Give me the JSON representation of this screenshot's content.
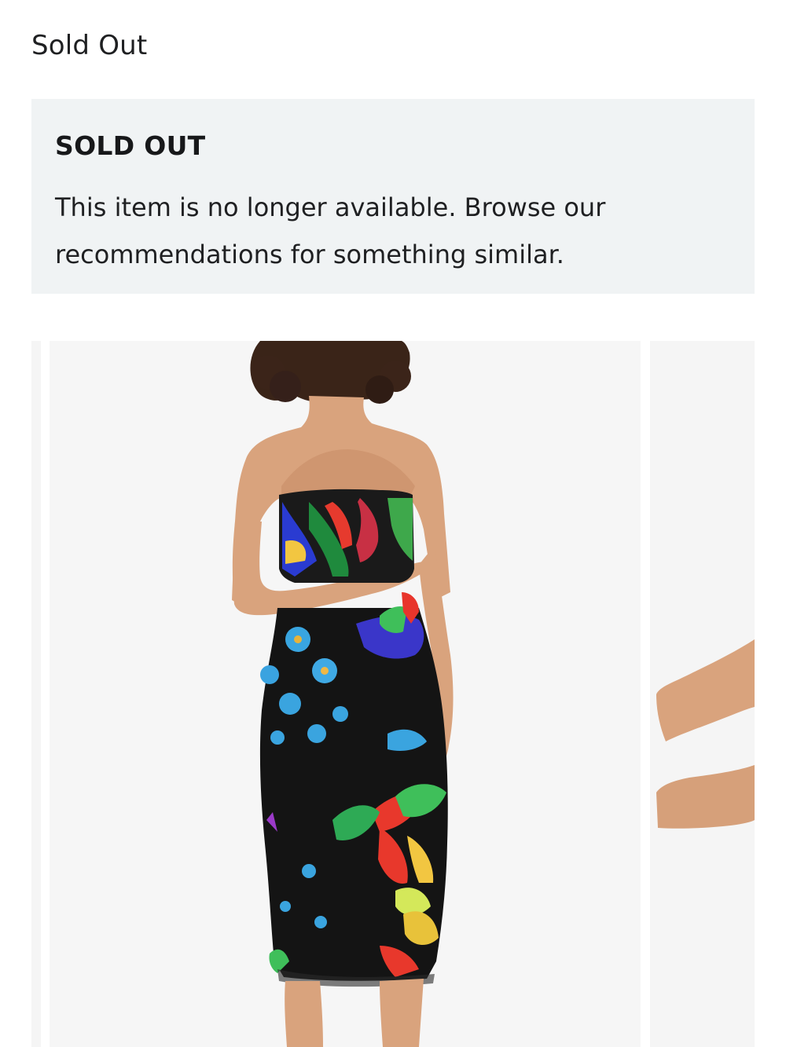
{
  "header": {
    "status_text": "Sold Out"
  },
  "notice": {
    "title": "SOLD OUT",
    "message": "This item is no longer available. Browse our recommendations for something similar."
  },
  "gallery": {
    "main_image_alt": "Model wearing a strapless black mesh midi dress with colorful floral print, back view",
    "next_image_alt": "Model's arm, next product image preview"
  },
  "colors": {
    "notice_background": "#f0f3f4",
    "image_background": "#f6f6f6"
  }
}
